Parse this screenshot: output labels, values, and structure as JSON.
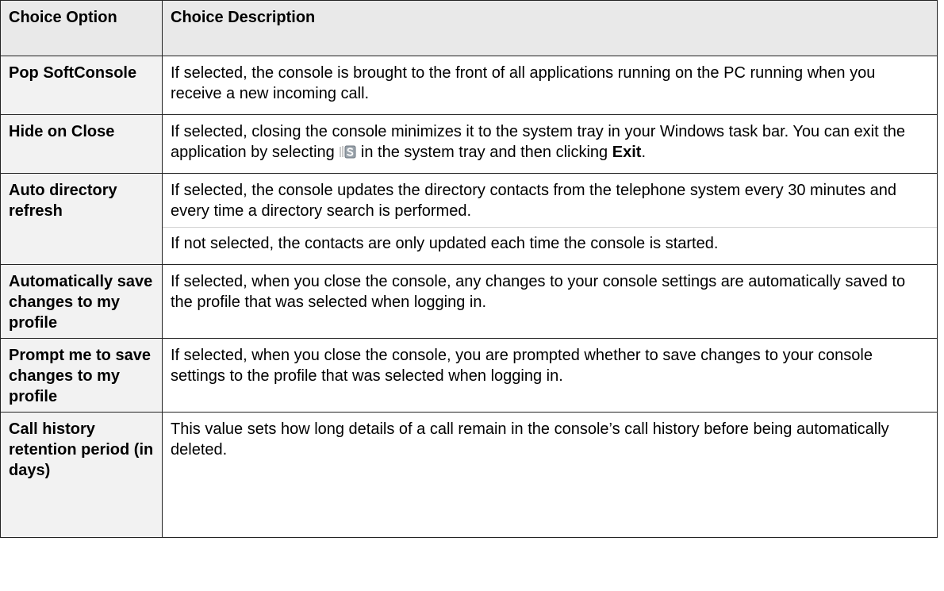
{
  "table": {
    "headers": {
      "option": "Choice Option",
      "description": "Choice Description"
    },
    "rows": [
      {
        "option": "Pop SoftConsole",
        "description": "If selected, the console is brought to the front of all applications running on the PC running when you receive a new incoming call."
      },
      {
        "option": "Hide on Close",
        "description_part1": "If selected, closing the console minimizes it to the system tray in your Windows task bar. You can exit the application by selecting",
        "icon": "softconsole-tray-icon",
        "description_part2": "in the system tray and then clicking",
        "description_bold": "Exit",
        "description_end": "."
      },
      {
        "option": "Auto directory refresh",
        "description": "If selected, the console updates the directory contacts from the telephone system every 30 minutes and every time a directory search is performed.",
        "description_note": "If not selected, the contacts are only updated each time the console is started."
      },
      {
        "option": "Automatically save changes to my profile",
        "description": "If selected, when you close the console, any changes to your console settings are automatically saved to the profile that was selected when logging in."
      },
      {
        "option": "Prompt me to save changes to my profile",
        "description": "If selected, when you close the console, you are prompted whether to save changes to your console settings to the profile that was selected when logging in."
      },
      {
        "option": "Call history retention period (in days)",
        "description": "This value sets how long details of a call remain in the console’s call history before being automatically deleted."
      }
    ]
  }
}
